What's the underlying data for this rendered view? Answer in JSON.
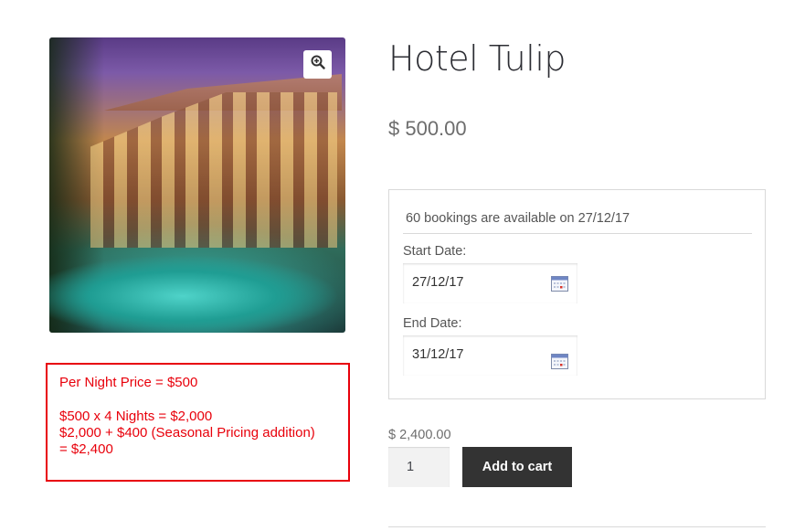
{
  "product": {
    "title": "Hotel Tulip",
    "price": "$ 500.00",
    "image_alt": "Hotel Tulip poolside view at night"
  },
  "note": {
    "line1": "Per Night Price = $500",
    "line2": "$500 x 4 Nights = $2,000",
    "line3": "$2,000 + $400 (Seasonal Pricing addition)",
    "line4": "= $2,400",
    "border_color": "#e8000b"
  },
  "booking": {
    "availability": "60 bookings are available on 27/12/17",
    "start_label": "Start Date:",
    "start_value": "27/12/17",
    "end_label": "End Date:",
    "end_value": "31/12/17"
  },
  "cart": {
    "subtotal": "$ 2,400.00",
    "quantity": "1",
    "add_label": "Add to cart",
    "button_color": "#333333"
  },
  "icons": {
    "zoom": "zoom-in-icon",
    "calendar": "calendar-icon"
  }
}
